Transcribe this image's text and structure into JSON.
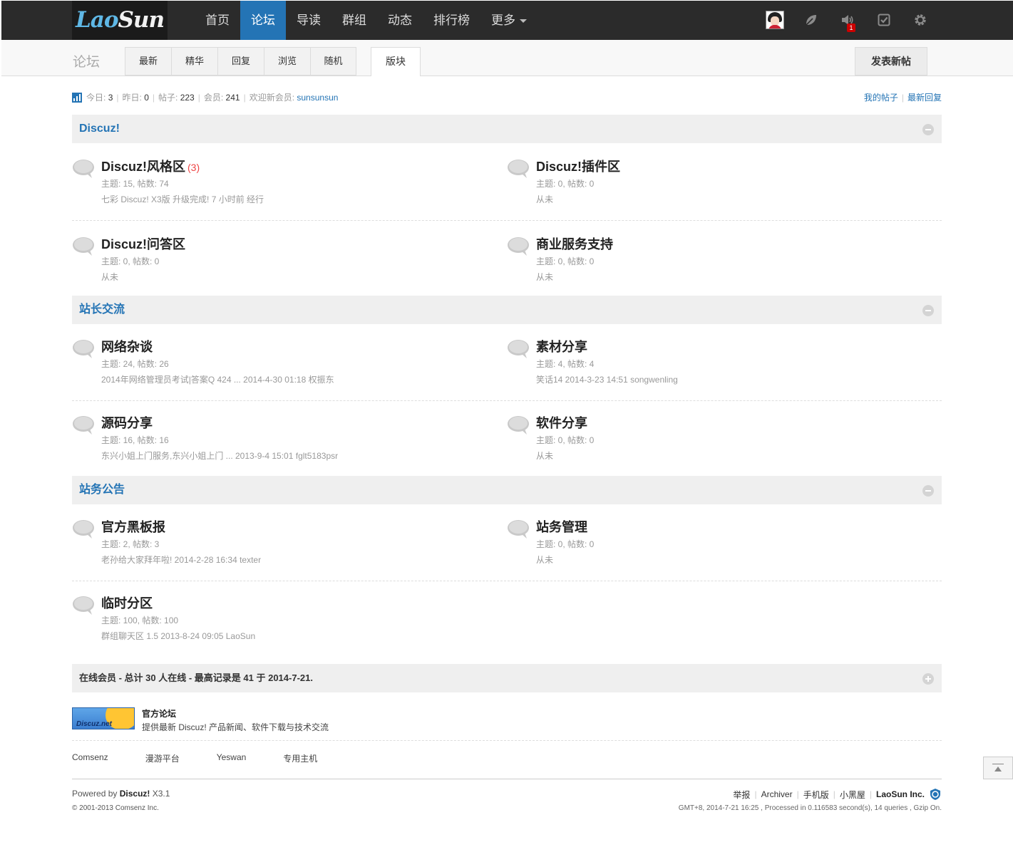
{
  "logo": {
    "part1": "Lao",
    "part2": "Sun"
  },
  "nav": {
    "items": [
      "首页",
      "论坛",
      "导读",
      "群组",
      "动态",
      "排行榜",
      "更多"
    ],
    "active_index": 1
  },
  "userbar": {
    "notice_count": "1"
  },
  "subhead": {
    "title": "论坛",
    "tabs": [
      "最新",
      "精华",
      "回复",
      "浏览",
      "随机"
    ],
    "active_tab": "版块",
    "newpost_label": "发表新帖"
  },
  "stats": {
    "today_label": "今日:",
    "today": "3",
    "yesterday_label": "昨日:",
    "yesterday": "0",
    "posts_label": "帖子:",
    "posts": "223",
    "members_label": "会员:",
    "members": "241",
    "welcome_label": "欢迎新会员:",
    "newest_member": "sunsunsun"
  },
  "toplinks": {
    "my_posts": "我的帖子",
    "latest_reply": "最新回复"
  },
  "categories": [
    {
      "title": "Discuz!",
      "forums": [
        {
          "name": "Discuz!风格区",
          "today": "(3)",
          "stats": "主题: 15, 帖数: 74",
          "last": "七彩 Discuz! X3版 升级完成!  7 小时前 经行"
        },
        {
          "name": "Discuz!插件区",
          "stats": "主题: 0, 帖数: 0",
          "last": "从未"
        },
        {
          "name": "Discuz!问答区",
          "stats": "主题: 0, 帖数: 0",
          "last": "从未"
        },
        {
          "name": "商业服务支持",
          "stats": "主题: 0, 帖数: 0",
          "last": "从未"
        }
      ]
    },
    {
      "title": "站长交流",
      "forums": [
        {
          "name": "网络杂谈",
          "stats": "主题: 24, 帖数: 26",
          "last": "2014年网络管理员考试|答案Q 424 ... 2014-4-30 01:18 权振东"
        },
        {
          "name": "素材分享",
          "stats": "主题: 4, 帖数: 4",
          "last": "笑话14 2014-3-23 14:51 songwenling"
        },
        {
          "name": "源码分享",
          "stats": "主题: 16, 帖数: 16",
          "last": "东兴小姐上门服务,东兴小姐上门 ... 2013-9-4 15:01 fglt5183psr"
        },
        {
          "name": "软件分享",
          "stats": "主题: 0, 帖数: 0",
          "last": "从未"
        }
      ]
    },
    {
      "title": "站务公告",
      "forums": [
        {
          "name": "官方黑板报",
          "stats": "主题: 2, 帖数: 3",
          "last": "老孙给大家拜年啦!  2014-2-28 16:34 texter"
        },
        {
          "name": "站务管理",
          "stats": "主题: 0, 帖数: 0",
          "last": "从未"
        },
        {
          "name": "临时分区",
          "stats": "主题: 100, 帖数: 100",
          "last": "群组聊天区 1.5 2013-8-24 09:05 LaoSun"
        }
      ]
    }
  ],
  "online": {
    "text": "在线会员 - 总计 30 人在线 - 最高记录是 41 于 2014-7-21."
  },
  "links": {
    "logo_text": "Discuz.net",
    "title": "官方论坛",
    "desc": "提供最新 Discuz! 产品新闻、软件下载与技术交流",
    "friends": [
      "Comsenz",
      "漫游平台",
      "Yeswan",
      "专用主机"
    ]
  },
  "footer": {
    "powered_prefix": "Powered by",
    "powered_brand": "Discuz!",
    "powered_version": "X3.1",
    "copyright": "© 2001-2013 Comsenz Inc.",
    "nav": [
      "举报",
      "Archiver",
      "手机版",
      "小黑屋"
    ],
    "brand": "LaoSun Inc.",
    "processed": "GMT+8, 2014-7-21 16:25 , Processed in 0.116583 second(s), 14 queries , Gzip On."
  },
  "colors": {
    "accent": "#2474b5",
    "topbar": "#2b2b2b",
    "today_count": "#ee4444"
  }
}
